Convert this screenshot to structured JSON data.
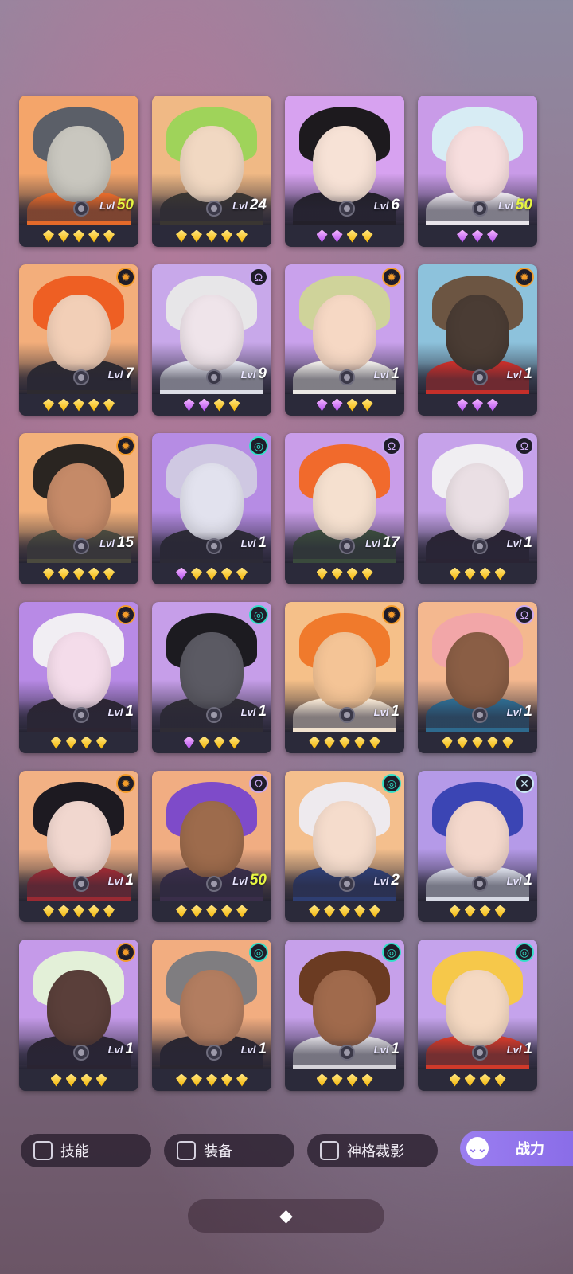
{
  "heroes": [
    {
      "level": "50",
      "level_highlight": true,
      "element": "",
      "stars": [
        "gold",
        "gold",
        "gold",
        "gold",
        "gold"
      ],
      "palette": {
        "bg": "#f4a56a",
        "hair": "#5b5f68",
        "skin": "#c9c7bf",
        "body": "#e56a2a"
      }
    },
    {
      "level": "24",
      "level_highlight": false,
      "element": "",
      "stars": [
        "gold",
        "gold",
        "gold",
        "gold",
        "gold"
      ],
      "palette": {
        "bg": "#f0b985",
        "hair": "#9fd35a",
        "skin": "#f1d8c2",
        "body": "#3a3632"
      }
    },
    {
      "level": "6",
      "level_highlight": false,
      "element": "",
      "stars": [
        "purple",
        "purple",
        "gold",
        "gold"
      ],
      "palette": {
        "bg": "#d7a2f0",
        "hair": "#1d1a1e",
        "skin": "#f7e2d6",
        "body": "#23202a"
      }
    },
    {
      "level": "50",
      "level_highlight": true,
      "element": "",
      "stars": [
        "purple",
        "purple",
        "purple"
      ],
      "palette": {
        "bg": "#c99be8",
        "hair": "#d7ecf4",
        "skin": "#f7dede",
        "body": "#e8e4ea"
      }
    },
    {
      "level": "7",
      "level_highlight": false,
      "element": "sun",
      "stars": [
        "gold",
        "gold",
        "gold",
        "gold",
        "gold"
      ],
      "palette": {
        "bg": "#f3ae7b",
        "hair": "#ee5f23",
        "skin": "#f2cfb7",
        "body": "#2d2a30"
      }
    },
    {
      "level": "9",
      "level_highlight": false,
      "element": "void",
      "stars": [
        "purple",
        "purple",
        "gold",
        "gold"
      ],
      "palette": {
        "bg": "#c8a8ea",
        "hair": "#e7e6e8",
        "skin": "#efe4ea",
        "body": "#dcdde6"
      }
    },
    {
      "level": "1",
      "level_highlight": false,
      "element": "sun",
      "stars": [
        "purple",
        "purple",
        "gold",
        "gold"
      ],
      "palette": {
        "bg": "#c9a1ec",
        "hair": "#cfd39a",
        "skin": "#f6d8c4",
        "body": "#ebe8e4"
      }
    },
    {
      "level": "1",
      "level_highlight": false,
      "element": "sun",
      "stars": [
        "purple",
        "purple",
        "purple"
      ],
      "palette": {
        "bg": "#8dc2dc",
        "hair": "#6c5542",
        "skin": "#4a3c34",
        "body": "#c52f2a"
      }
    },
    {
      "level": "15",
      "level_highlight": false,
      "element": "sun",
      "stars": [
        "gold",
        "gold",
        "gold",
        "gold",
        "gold"
      ],
      "palette": {
        "bg": "#f3b17a",
        "hair": "#2a2521",
        "skin": "#c58a68",
        "body": "#4b4a3e"
      }
    },
    {
      "level": "1",
      "level_highlight": false,
      "element": "swirl",
      "stars": [
        "purple",
        "gold",
        "gold",
        "gold",
        "gold"
      ],
      "palette": {
        "bg": "#b68ce4",
        "hair": "#cfc8e2",
        "skin": "#e2e2ee",
        "body": "#2c2a36"
      }
    },
    {
      "level": "17",
      "level_highlight": false,
      "element": "void",
      "stars": [
        "gold",
        "gold",
        "gold",
        "gold"
      ],
      "palette": {
        "bg": "#c99de9",
        "hair": "#f16a2c",
        "skin": "#f5e0cf",
        "body": "#3a4a3c"
      }
    },
    {
      "level": "1",
      "level_highlight": false,
      "element": "void",
      "stars": [
        "gold",
        "gold",
        "gold",
        "gold"
      ],
      "palette": {
        "bg": "#c6a2ea",
        "hair": "#f0eef2",
        "skin": "#eadfe4",
        "body": "#2a2434"
      }
    },
    {
      "level": "1",
      "level_highlight": false,
      "element": "sun",
      "stars": [
        "gold",
        "gold",
        "gold",
        "gold"
      ],
      "palette": {
        "bg": "#b88ae6",
        "hair": "#f1eef3",
        "skin": "#f4dcea",
        "body": "#2c2533"
      }
    },
    {
      "level": "1",
      "level_highlight": false,
      "element": "swirl",
      "stars": [
        "purple",
        "gold",
        "gold",
        "gold"
      ],
      "palette": {
        "bg": "#c69ee9",
        "hair": "#1c1b20",
        "skin": "#5b5a63",
        "body": "#2f2c35"
      }
    },
    {
      "level": "1",
      "level_highlight": false,
      "element": "sun",
      "stars": [
        "gold",
        "gold",
        "gold",
        "gold",
        "gold"
      ],
      "palette": {
        "bg": "#f5c089",
        "hair": "#f07a2c",
        "skin": "#f4c496",
        "body": "#f1e2cf"
      }
    },
    {
      "level": "1",
      "level_highlight": false,
      "element": "void",
      "stars": [
        "gold",
        "gold",
        "gold",
        "gold",
        "gold"
      ],
      "palette": {
        "bg": "#f4b88f",
        "hair": "#f2a6a8",
        "skin": "#8a5e45",
        "body": "#2e6a8e"
      }
    },
    {
      "level": "1",
      "level_highlight": false,
      "element": "sun",
      "stars": [
        "gold",
        "gold",
        "gold",
        "gold",
        "gold"
      ],
      "palette": {
        "bg": "#f2b184",
        "hair": "#1d1a21",
        "skin": "#f1d7cf",
        "body": "#9a2a33"
      }
    },
    {
      "level": "50",
      "level_highlight": true,
      "element": "void",
      "stars": [
        "gold",
        "gold",
        "gold",
        "gold",
        "gold"
      ],
      "palette": {
        "bg": "#f1ad82",
        "hair": "#7e4bc9",
        "skin": "#9d6b4c",
        "body": "#3a2e4a"
      }
    },
    {
      "level": "2",
      "level_highlight": false,
      "element": "swirl",
      "stars": [
        "gold",
        "gold",
        "gold",
        "gold",
        "gold"
      ],
      "palette": {
        "bg": "#f4bf8d",
        "hair": "#eeeaee",
        "skin": "#f5dccc",
        "body": "#2e3e72"
      }
    },
    {
      "level": "1",
      "level_highlight": false,
      "element": "cross",
      "stars": [
        "gold",
        "gold",
        "gold",
        "gold"
      ],
      "palette": {
        "bg": "#b59ae8",
        "hair": "#3b45b4",
        "skin": "#f4d8cc",
        "body": "#d6d9e4"
      }
    },
    {
      "level": "1",
      "level_highlight": false,
      "element": "sun",
      "stars": [
        "gold",
        "gold",
        "gold",
        "gold"
      ],
      "palette": {
        "bg": "#c59ae9",
        "hair": "#e3f0d8",
        "skin": "#5a3f3a",
        "body": "#2a2432"
      }
    },
    {
      "level": "1",
      "level_highlight": false,
      "element": "swirl",
      "stars": [
        "gold",
        "gold",
        "gold",
        "gold",
        "gold"
      ],
      "palette": {
        "bg": "#f2ad80",
        "hair": "#7f7d80",
        "skin": "#b27d60",
        "body": "#2a2630"
      }
    },
    {
      "level": "1",
      "level_highlight": false,
      "element": "swirl",
      "stars": [
        "gold",
        "gold",
        "gold",
        "gold"
      ],
      "palette": {
        "bg": "#c6a0ea",
        "hair": "#6b3b22",
        "skin": "#a06a4c",
        "body": "#d6d4da"
      }
    },
    {
      "level": "1",
      "level_highlight": false,
      "element": "swirl",
      "stars": [
        "gold",
        "gold",
        "gold",
        "gold"
      ],
      "palette": {
        "bg": "#c5a3ec",
        "hair": "#f6c84a",
        "skin": "#f5d9c2",
        "body": "#d03a2a"
      }
    }
  ],
  "level_prefix": "Lvl",
  "element_glyphs": {
    "sun": "✹",
    "void": "Ω",
    "swirl": "◎",
    "cross": "✕",
    "": ""
  },
  "element_colors": {
    "sun": "#f39b2a",
    "void": "#c9a8f2",
    "swirl": "#31e0c8",
    "cross": "#c9e8f4",
    "": "transparent"
  },
  "filters": {
    "skill": "技能",
    "equipment": "装备",
    "shadow": "神格裁影"
  },
  "sort": {
    "label": "战力",
    "icon": "chevron-double-down-icon"
  },
  "bottom_handle_icon": "◆"
}
